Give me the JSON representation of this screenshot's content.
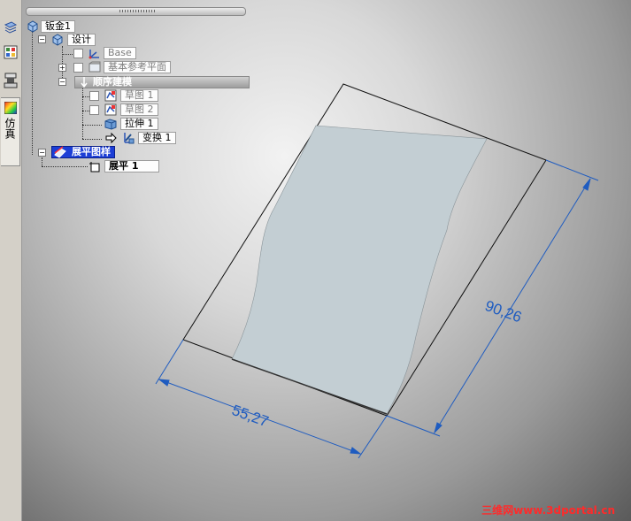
{
  "side_strip": {
    "buttons": [
      "layers-icon",
      "parts-icon",
      "assembly-icon",
      "colormap-icon"
    ],
    "simulation_tab_label": "仿真"
  },
  "tree": {
    "root_label": "钣金1",
    "design_label": "设计",
    "base_label": "Base",
    "ref_planes_label": "基本参考平面",
    "ordered_label": "顺序建模",
    "sketch1_label": "草图 1",
    "sketch2_label": "草图 2",
    "extrude_label": "拉伸 1",
    "transform_label": "变换 1",
    "flatten_group_label": "展平图样",
    "flatten_label": "展平 1"
  },
  "viewport": {
    "dimension_width": "55,27",
    "dimension_height": "90,26",
    "dimension_color": "#1f5cc0",
    "surface_color": "#c3ced3"
  },
  "watermark": "三维网www.3dportal.cn"
}
